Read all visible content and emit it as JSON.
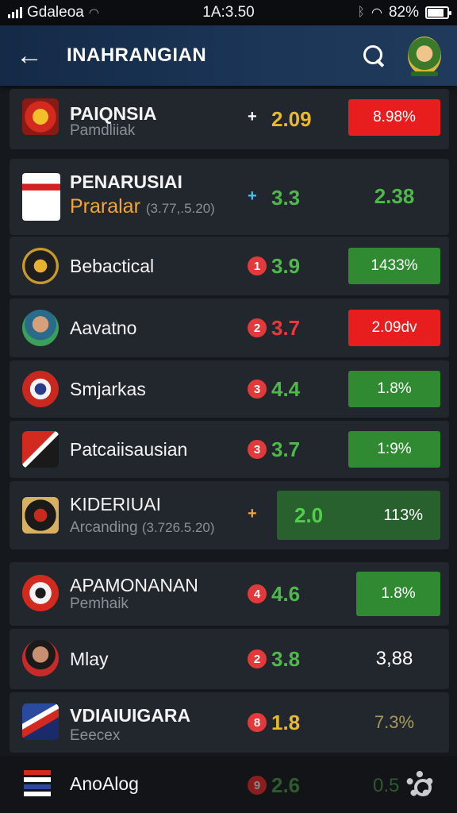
{
  "status": {
    "carrier": "Gdaleoa",
    "time": "1A:3.50",
    "battery": "82%"
  },
  "appbar": {
    "title": "INAHRANGIAN"
  },
  "rows": [
    {
      "name": "PAIQNSIA",
      "sub": "Pamdliiak",
      "trend": "+",
      "score": "2.09",
      "pill": "8.98%"
    },
    {
      "name": "PENARUSIAI",
      "sub": "Praralar",
      "sub_extra": "(3.77,.5.20)",
      "trend": "+",
      "score": "3.3",
      "pill": "2.38"
    },
    {
      "name": "Bebactical",
      "rank": "1",
      "score": "3.9",
      "pill": "1433%"
    },
    {
      "name": "Aavatno",
      "rank": "2",
      "score": "3.7",
      "pill": "2.09dv"
    },
    {
      "name": "Smjarkas",
      "rank": "3",
      "score": "4.4",
      "pill": "1.8%"
    },
    {
      "name": "Patcaiisausian",
      "rank": "3",
      "score": "3.7",
      "pill": "1:9%"
    },
    {
      "name": "KIDERIUAI",
      "sub": "Arcanding",
      "sub_extra": "(3.726.5.20)",
      "trend": "+",
      "score": "2.0",
      "pill": "113%"
    },
    {
      "name": "APAMONANAN",
      "sub": "Pemhaik",
      "rank": "4",
      "score": "4.6",
      "pill": "1.8%"
    },
    {
      "name": "Mlay",
      "rank": "2",
      "score": "3.8",
      "pill": "3,88"
    },
    {
      "name": "VDIAIUIGARA",
      "sub": "Eeecex",
      "rank": "8",
      "score": "1.8",
      "pill": "7.3%"
    },
    {
      "name": "AnoAlog",
      "rank": "9",
      "score": "2.6",
      "pill": "0.5"
    }
  ],
  "colors": {
    "red": "#e81e1e",
    "green": "#2f8a32",
    "yellow": "#e8b830"
  }
}
